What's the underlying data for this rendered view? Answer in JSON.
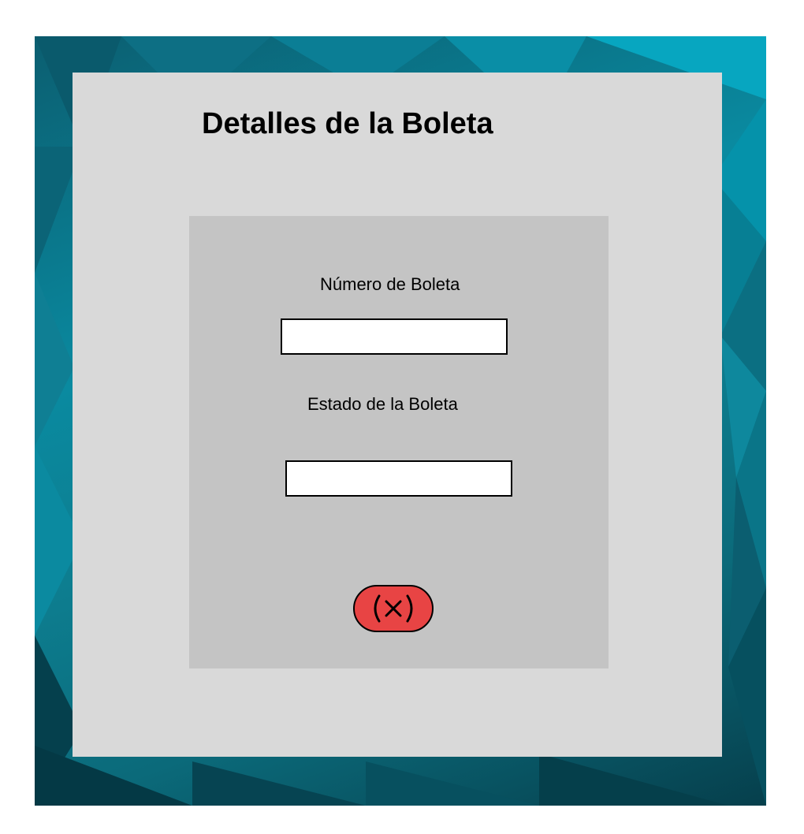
{
  "dialog": {
    "title": "Detalles de la Boleta",
    "fields": [
      {
        "label": "Número de Boleta",
        "value": "",
        "placeholder": ""
      },
      {
        "label": "Estado de la Boleta",
        "value": "",
        "placeholder": ""
      }
    ],
    "close_button": {
      "icon": "close-circle-icon",
      "color": "#e84444"
    }
  },
  "colors": {
    "background_accent": "#0a8aa0",
    "card": "#d9d9d9",
    "panel": "#c4c4c4"
  }
}
